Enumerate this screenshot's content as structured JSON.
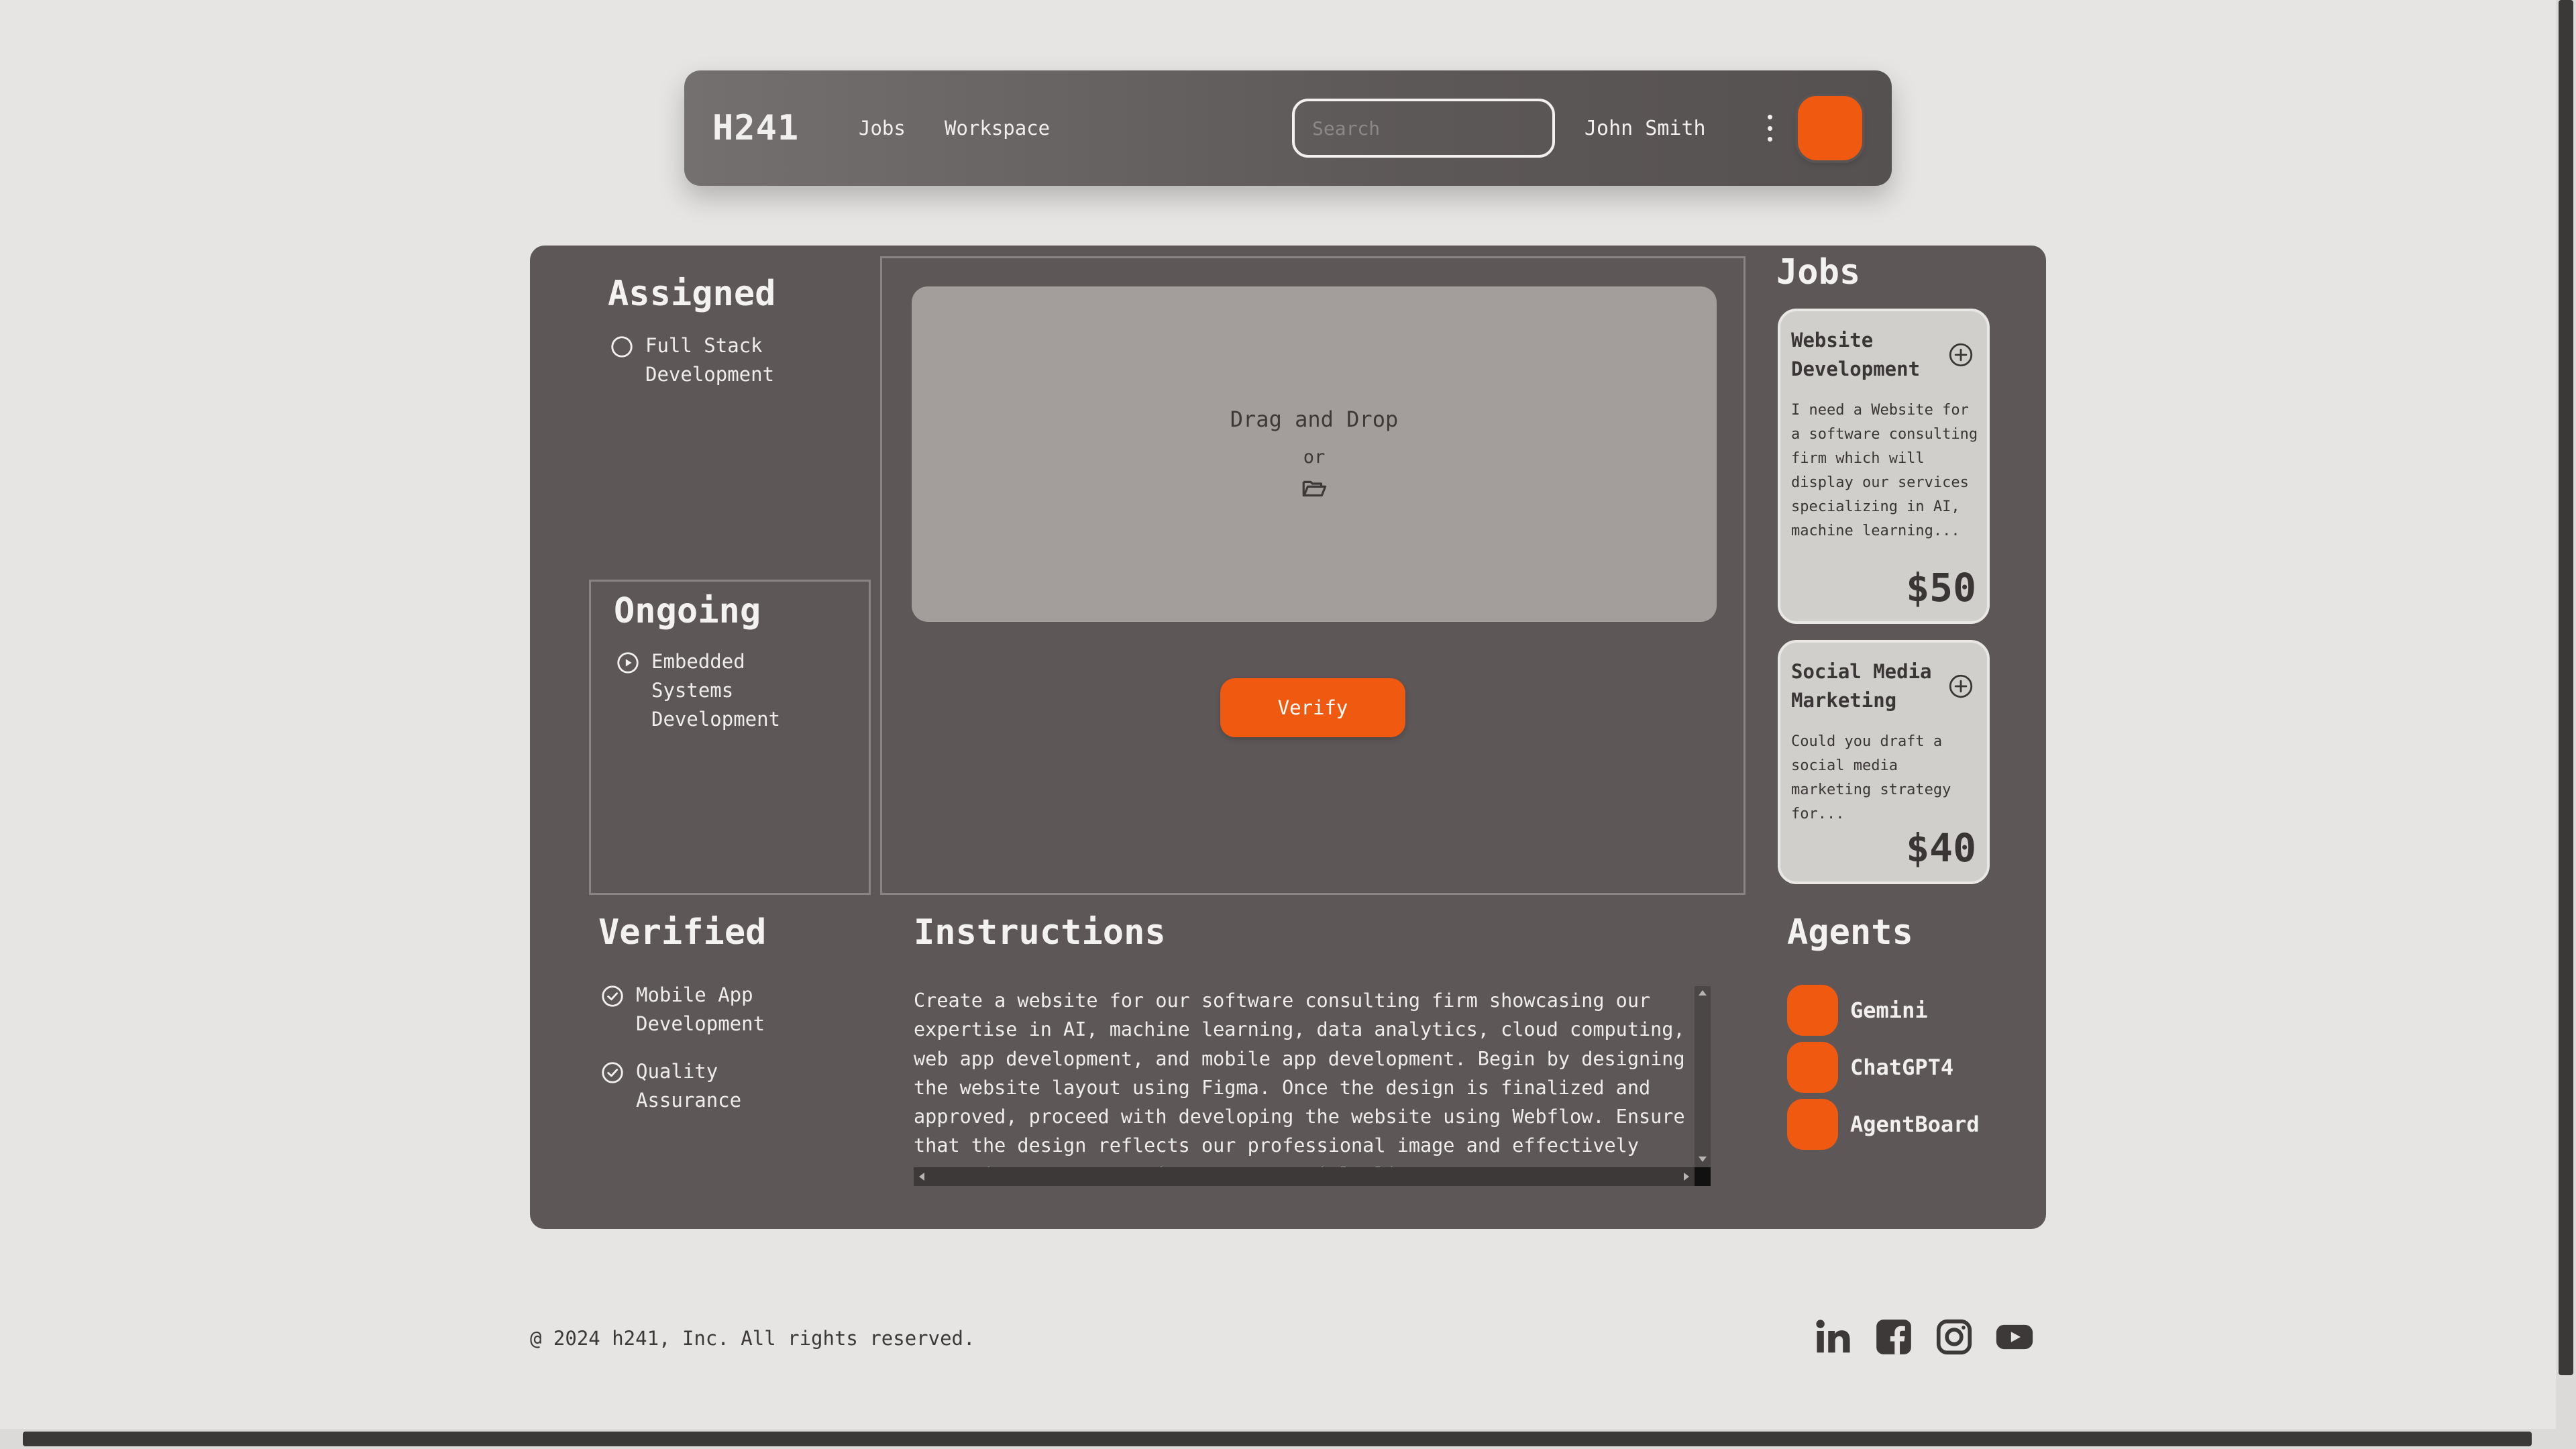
{
  "nav": {
    "brand": "H241",
    "links": [
      "Jobs",
      "Workspace"
    ],
    "search_placeholder": "Search",
    "user_name": "John Smith"
  },
  "assigned": {
    "title": "Assigned",
    "items": [
      "Full Stack Development"
    ]
  },
  "ongoing": {
    "title": "Ongoing",
    "items": [
      "Embedded Systems Development"
    ]
  },
  "verified": {
    "title": "Verified",
    "items": [
      "Mobile App Development",
      "Quality Assurance"
    ]
  },
  "dropzone": {
    "title": "Drag and Drop",
    "or": "or"
  },
  "verify_label": "Verify",
  "jobs": {
    "title": "Jobs",
    "cards": [
      {
        "title": "Website Development",
        "description": "I need a Website for a software consulting firm which will display our services specializing in AI, machine learning...",
        "price": "$50"
      },
      {
        "title": "Social Media Marketing",
        "description": "Could you draft a social media marketing strategy for...",
        "price": "$40"
      }
    ]
  },
  "instructions": {
    "title": "Instructions",
    "text": "Create a website for our software consulting firm showcasing our expertise in AI, machine learning, data analytics, cloud computing, web app development, and mobile app development. Begin by designing the website layout using Figma. Once the design is finalized and approved, proceed with developing the website using Webflow. Ensure that the design reflects our professional image and effectively communicates our services to potential clients."
  },
  "agents": {
    "title": "Agents",
    "items": [
      "Gemini",
      "ChatGPT4",
      "AgentBoard"
    ]
  },
  "footer": {
    "copyright": "@ 2024 h241, Inc. All rights reserved.",
    "social_icons": [
      "linkedin-icon",
      "facebook-icon",
      "instagram-icon",
      "youtube-icon"
    ]
  },
  "colors": {
    "accent": "#f05a10",
    "panel": "#5d5758",
    "page_bg": "#e6e5e3",
    "card": "#d1cfcc"
  }
}
